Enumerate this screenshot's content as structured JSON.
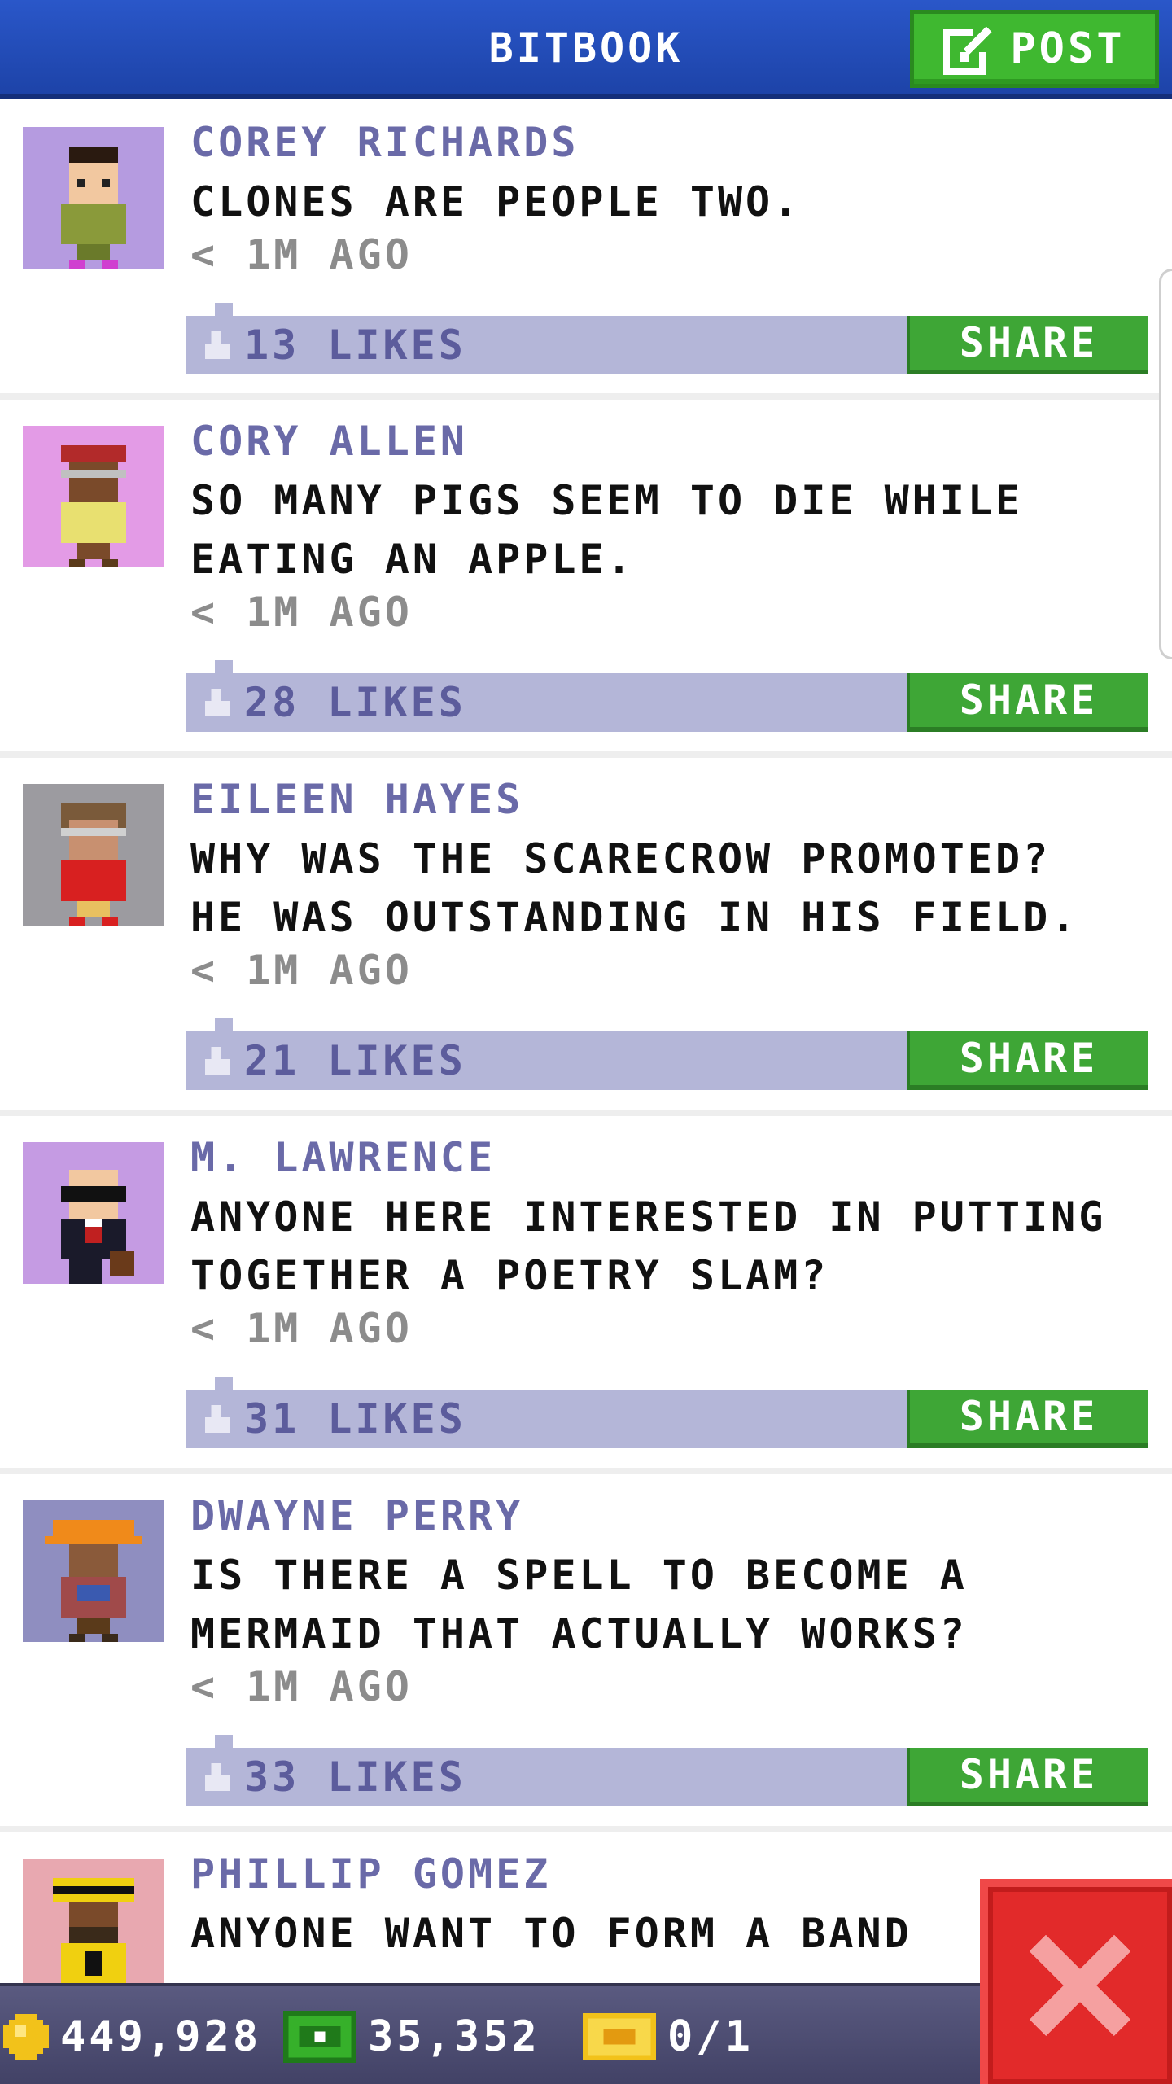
{
  "header": {
    "title": "BITBOOK",
    "post_label": "POST",
    "post_icon": "edit-icon"
  },
  "posts": [
    {
      "author": "COREY RICHARDS",
      "message": "CLONES ARE PEOPLE TWO.",
      "time": "< 1M AGO",
      "likes": "13 LIKES",
      "share": "SHARE",
      "avatar_bg": "#b59be0"
    },
    {
      "author": "CORY ALLEN",
      "message": "SO MANY PIGS SEEM TO DIE WHILE\nEATING AN APPLE.",
      "time": "< 1M AGO",
      "likes": "28 LIKES",
      "share": "SHARE",
      "avatar_bg": "#e39be6"
    },
    {
      "author": "EILEEN HAYES",
      "message": "WHY WAS THE SCARECROW PROMOTED?\nHE WAS OUTSTANDING IN HIS FIELD.",
      "time": "< 1M AGO",
      "likes": "21 LIKES",
      "share": "SHARE",
      "avatar_bg": "#9c9ba0"
    },
    {
      "author": "M. LAWRENCE",
      "message": "ANYONE HERE INTERESTED IN PUTTING\nTOGETHER A POETRY SLAM?",
      "time": "< 1M AGO",
      "likes": "31 LIKES",
      "share": "SHARE",
      "avatar_bg": "#c59be3"
    },
    {
      "author": "DWAYNE PERRY",
      "message": "IS THERE A SPELL TO BECOME A\nMERMAID THAT ACTUALLY WORKS?",
      "time": "< 1M AGO",
      "likes": "33 LIKES",
      "share": "SHARE",
      "avatar_bg": "#8f8ec0"
    },
    {
      "author": "PHILLIP GOMEZ",
      "message": "ANYONE WANT TO FORM A BAND",
      "avatar_bg": "#e8a8b0"
    }
  ],
  "bottom_bar": {
    "coins": "449,928",
    "coin_icon": "coin-icon",
    "bux": "35,352",
    "bux_icon": "bux-icon",
    "tickets": "0/1",
    "ticket_icon": "ticket-icon"
  },
  "close_icon": "close-icon",
  "colors": {
    "header_blue": "#2a57c9",
    "button_green": "#3ea636",
    "author_purple": "#6a6aa8",
    "likes_bar": "#b4b6d8",
    "close_red": "#e22a2a",
    "bottom_bar": "#4e4e72"
  }
}
